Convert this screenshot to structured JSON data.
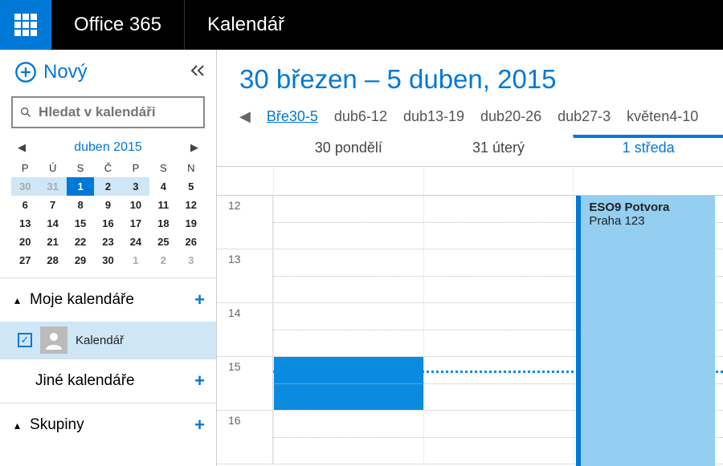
{
  "header": {
    "brand": "Office 365",
    "app": "Kalendář"
  },
  "sidebar": {
    "new_label": "Nový",
    "search_placeholder": "Hledat v kalendáři",
    "mini": {
      "month_label": "duben 2015",
      "dow": [
        "P",
        "Ú",
        "S",
        "Č",
        "P",
        "S",
        "N"
      ],
      "weeks": [
        [
          {
            "d": "30",
            "muted": true,
            "ws": true
          },
          {
            "d": "31",
            "muted": true,
            "ws": true
          },
          {
            "d": "1",
            "today": true,
            "ws": true
          },
          {
            "d": "2",
            "ws": true
          },
          {
            "d": "3",
            "ws": true
          },
          {
            "d": "4"
          },
          {
            "d": "5"
          }
        ],
        [
          {
            "d": "6"
          },
          {
            "d": "7"
          },
          {
            "d": "8"
          },
          {
            "d": "9"
          },
          {
            "d": "10"
          },
          {
            "d": "11"
          },
          {
            "d": "12"
          }
        ],
        [
          {
            "d": "13"
          },
          {
            "d": "14"
          },
          {
            "d": "15"
          },
          {
            "d": "16"
          },
          {
            "d": "17"
          },
          {
            "d": "18"
          },
          {
            "d": "19"
          }
        ],
        [
          {
            "d": "20"
          },
          {
            "d": "21"
          },
          {
            "d": "22"
          },
          {
            "d": "23"
          },
          {
            "d": "24"
          },
          {
            "d": "25"
          },
          {
            "d": "26"
          }
        ],
        [
          {
            "d": "27"
          },
          {
            "d": "28"
          },
          {
            "d": "29"
          },
          {
            "d": "30"
          },
          {
            "d": "1",
            "muted": true
          },
          {
            "d": "2",
            "muted": true
          },
          {
            "d": "3",
            "muted": true
          }
        ]
      ]
    },
    "sections": {
      "my_cal": "Moje kalendáře",
      "other_cal": "Jiné kalendáře",
      "groups": "Skupiny",
      "calendar_item": "Kalendář"
    }
  },
  "main": {
    "range": "30 březen – 5 duben, 2015",
    "weeks": [
      "Bře30-5",
      "dub6-12",
      "dub13-19",
      "dub20-26",
      "dub27-3",
      "květen4-10"
    ],
    "active_week": 0,
    "days": [
      "30 pondělí",
      "31 úterý",
      "1 středa"
    ],
    "active_day": 2,
    "hours": [
      "12",
      "13",
      "14",
      "15",
      "16"
    ],
    "event": {
      "title": "ESO9 Potvora",
      "location": "Praha 123"
    }
  }
}
